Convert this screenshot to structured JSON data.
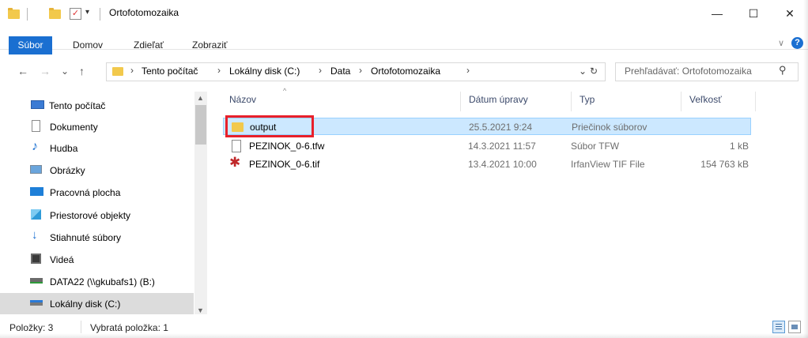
{
  "window": {
    "title": "Ortofotomozaika",
    "minimize_glyph": "—",
    "maximize_glyph": "☐",
    "close_glyph": "✕"
  },
  "ribbon": {
    "tabs": [
      "Súbor",
      "Domov",
      "Zdieľať",
      "Zobraziť"
    ],
    "expand_glyph": "∨",
    "help_glyph": "?"
  },
  "address": {
    "back_glyph": "←",
    "forward_glyph": "→",
    "recent_glyph": "⌄",
    "up_glyph": "↑",
    "crumbs": [
      "Tento počítač",
      "Lokálny disk (C:)",
      "Data",
      "Ortofotomozaika"
    ],
    "crumb_sep": "›",
    "dropdown_glyph": "⌄",
    "refresh_glyph": "↻"
  },
  "search": {
    "placeholder": "Prehľadávať: Ortofotomozaika",
    "icon_glyph": "⚲"
  },
  "nav": {
    "items": [
      {
        "label": "Tento počítač",
        "icon": "computer-icon"
      },
      {
        "label": "Dokumenty",
        "icon": "document-icon"
      },
      {
        "label": "Hudba",
        "icon": "music-icon"
      },
      {
        "label": "Obrázky",
        "icon": "pictures-icon"
      },
      {
        "label": "Pracovná plocha",
        "icon": "desktop-icon"
      },
      {
        "label": "Priestorové objekty",
        "icon": "3d-objects-icon"
      },
      {
        "label": "Stiahnuté súbory",
        "icon": "download-icon"
      },
      {
        "label": "Videá",
        "icon": "video-icon"
      },
      {
        "label": "DATA22 (\\\\gkubafs1) (B:)",
        "icon": "network-drive-icon"
      },
      {
        "label": "Lokálny disk (C:)",
        "icon": "local-disk-icon"
      }
    ],
    "selected_index": 9
  },
  "columns": {
    "name": "Názov",
    "date": "Dátum úpravy",
    "type": "Typ",
    "size": "Veľkosť"
  },
  "files": [
    {
      "name": "output",
      "date": "25.5.2021 9:24",
      "type": "Priečinok súborov",
      "size": "",
      "icon": "folder-icon",
      "selected": true
    },
    {
      "name": "PEZINOK_0-6.tfw",
      "date": "14.3.2021 11:57",
      "type": "Súbor TFW",
      "size": "1 kB",
      "icon": "text-file-icon",
      "selected": false
    },
    {
      "name": "PEZINOK_0-6.tif",
      "date": "13.4.2021 10:00",
      "type": "IrfanView TIF File",
      "size": "154 763 kB",
      "icon": "irfanview-icon",
      "selected": false
    }
  ],
  "status": {
    "items": "Položky: 3",
    "selected": "Vybratá položka: 1"
  },
  "colors": {
    "accent": "#1a6fd1",
    "selection": "#cce8ff",
    "highlight_box": "#e8202a"
  }
}
